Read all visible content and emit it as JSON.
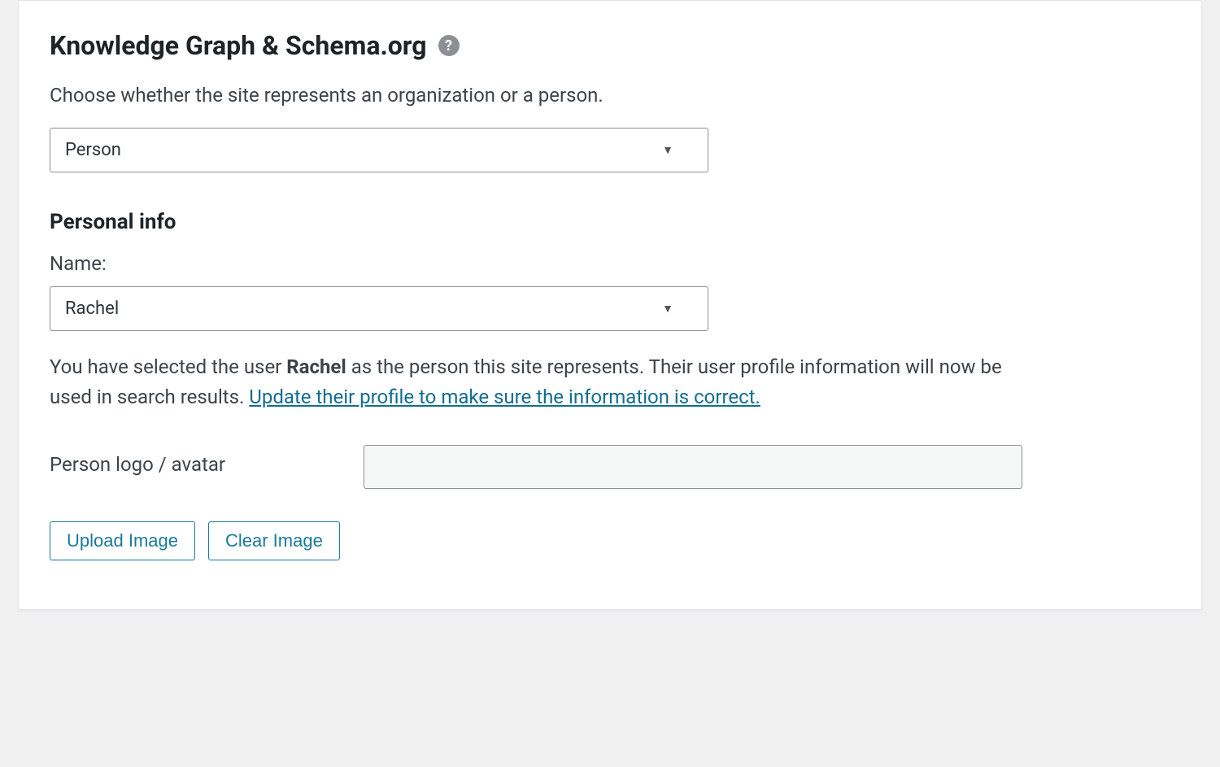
{
  "section": {
    "title": "Knowledge Graph & Schema.org",
    "help_icon": "?",
    "description": "Choose whether the site represents an organization or a person."
  },
  "entity_select": {
    "value": "Person"
  },
  "personal_info": {
    "heading": "Personal info",
    "name_label": "Name:",
    "name_value": "Rachel",
    "note_prefix": "You have selected the user ",
    "note_user": "Rachel",
    "note_middle": " as the person this site represents. Their user profile information will now be used in search results. ",
    "note_link": "Update their profile to make sure the information is correct.",
    "avatar_label": "Person logo / avatar"
  },
  "buttons": {
    "upload": "Upload Image",
    "clear": "Clear Image"
  }
}
